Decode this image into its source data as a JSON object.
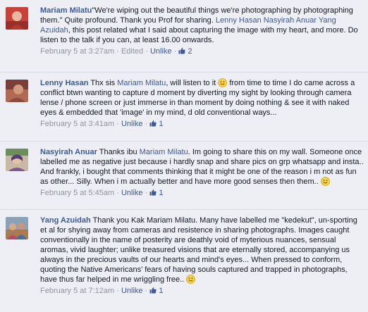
{
  "colors": {
    "link": "#3b5998",
    "meta": "#90949c",
    "background": "#edeff4"
  },
  "comments": [
    {
      "author": "Mariam Milatu",
      "t1": "\"We're wiping out the beautiful things we're photographing by photographing them.\" Quite profound. Thank you Prof for sharing. ",
      "m1": "Lenny Hasan",
      "t2": " ",
      "m2": "Nasyirah Anuar",
      "t3": " ",
      "m3": "Yang Azuidah",
      "t4": ", this post related what I said about capturing the image with my heart, and more. Do listen to the talk if you can, at least 16.00 onwards.",
      "timestamp": "February 5 at 3:27am",
      "sep1": " · ",
      "edited": "Edited",
      "sep2": " · ",
      "unlike": "Unlike",
      "sep3": " · ",
      "likes": "2"
    },
    {
      "author": "Lenny Hasan",
      "t1": " Thx sis ",
      "m1": "Mariam Milatu",
      "t2": ", will listen to it ",
      "t3": " from time to time I do came across a conflict btwn wanting to capture d moment by diverting my sight by looking through camera lense / phone screen or just immerse in than moment by doing nothing & see it with naked eyes & embedded that 'image' in my mind, d old conventional ways...",
      "timestamp": "February 5 at 3:41am",
      "sep1": " · ",
      "unlike": "Unlike",
      "sep2": " · ",
      "likes": "1"
    },
    {
      "author": "Nasyirah Anuar",
      "t1": " Thanks ibu ",
      "m1": "Mariam Milatu",
      "t2": ". Im going to share this on my wall. Someone once labelled me as negative just because i hardly snap and share pics on grp whatsapp and insta.. And frankly, i bought that comments thinking that it might be one of the reason i m not as fun as other... Silly. When i m actually better and have more good senses then them.. ",
      "timestamp": "February 5 at 5:45am",
      "sep1": " · ",
      "unlike": "Unlike",
      "sep2": " · ",
      "likes": "1"
    },
    {
      "author": "Yang Azuidah",
      "t1": " Thank you Kak Mariam Milatu. Many have labelled me \"kedekut\", un-sporting et al for shying away from cameras and resistence in sharing photographs. Images caught conventionally in the name of posterity are deathly void of myterious nuances, sensual aromas, vivid laughter; unlike treasured visions that are eternally stored, accompanying us always in the precious vaults of our hearts and mind's eyes... When pressed to conform, quoting the Native Americans' fears of having souls captured and trapped in photographs, have thus far helped in me wriggling free.. ",
      "timestamp": "February 5 at 7:12am",
      "sep1": " · ",
      "unlike": "Unlike",
      "sep2": " · ",
      "likes": "1"
    }
  ]
}
